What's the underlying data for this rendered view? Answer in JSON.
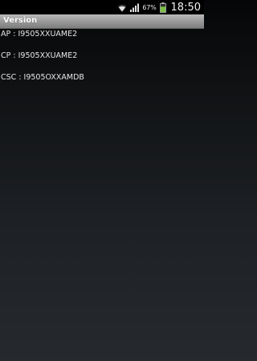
{
  "status_bar": {
    "wifi_icon": "wifi-icon",
    "signal_icon": "signal-icon",
    "battery_icon": "battery-icon",
    "battery_percent": "67%",
    "battery_level": 0.67,
    "time": "18:50"
  },
  "title_bar": {
    "title": "Version"
  },
  "versions": [
    {
      "text": "AP : I9505XXUAME2"
    },
    {
      "text": "CP : I9505XXUAME2"
    },
    {
      "text": "CSC : I9505OXXAMDB"
    }
  ],
  "colors": {
    "battery_fill": "#7ac142",
    "title_bar": "#9a9a9a",
    "background_top": "#050607",
    "background_bottom": "#26292e"
  }
}
